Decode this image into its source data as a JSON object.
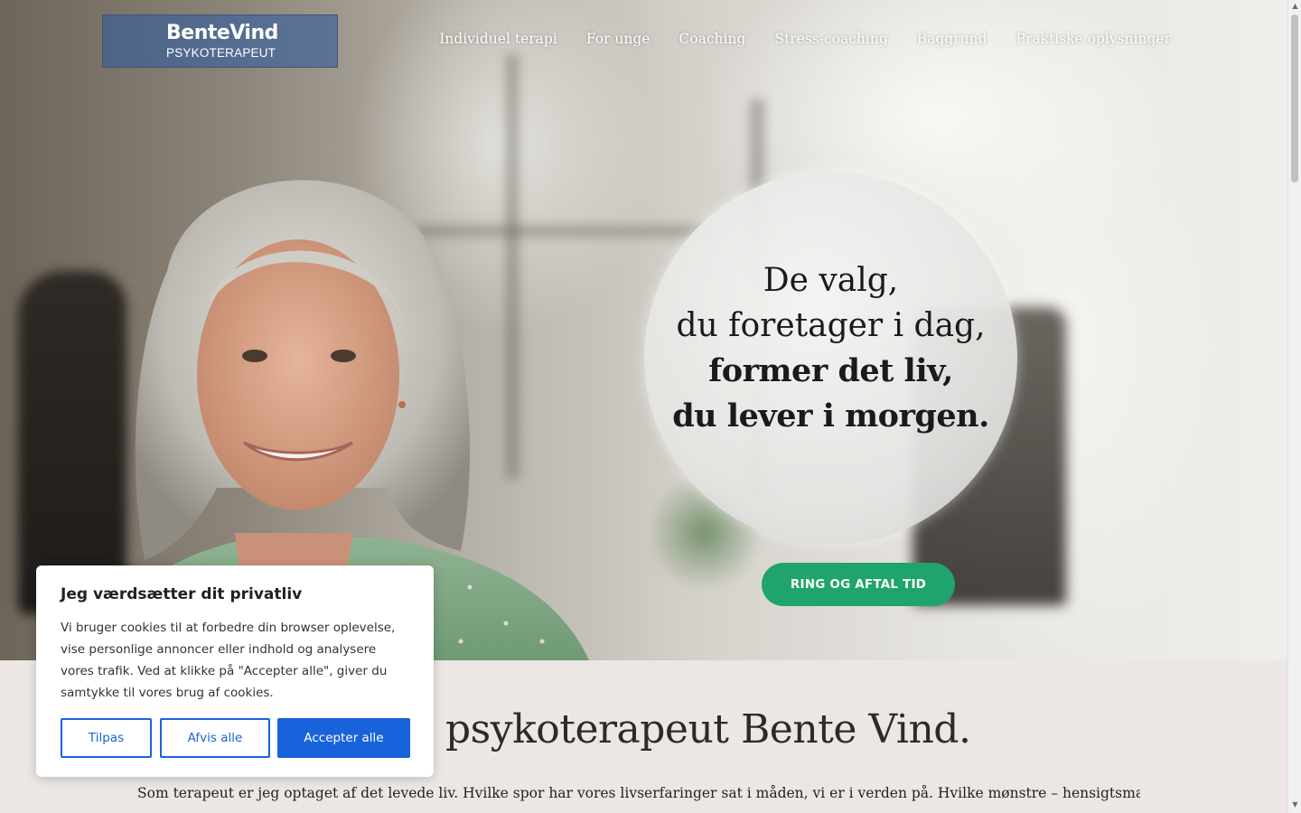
{
  "header": {
    "logo_name": "BenteVind",
    "logo_sub": "PSYKOTERAPEUT",
    "nav": [
      "Individuel terapi",
      "For unge",
      "Coaching",
      "Stress-coaching",
      "Baggrund",
      "Praktiske oplysninger"
    ]
  },
  "hero": {
    "quote_lines": [
      "De valg,",
      "du foretager i dag,",
      "former det liv,",
      "du lever i morgen."
    ],
    "cta_label": "RING OG AFTAL TID"
  },
  "intro": {
    "heading": "psykoterapeut Bente Vind.",
    "text": "Som terapeut er jeg optaget af det levede liv. Hvilke spor har vores livserfaringer sat i måden, vi er i verden på. Hvilke mønstre – hensigtsmæssige eller det"
  },
  "cookie": {
    "title": "Jeg værdsætter dit privatliv",
    "body": "Vi bruger cookies til at forbedre din browser oplevelse, vise personlige annoncer eller indhold og analysere vores trafik. Ved at klikke på \"Accepter alle\", giver du samtykke til vores brug af cookies.",
    "customize_label": "Tilpas",
    "reject_label": "Afvis alle",
    "accept_label": "Accepter alle"
  },
  "colors": {
    "logo_bg": "#4d6487",
    "cta_bg": "#1fa46d",
    "cookie_primary": "#1863dc",
    "content_bg": "#ece7e4"
  },
  "icons": {
    "scroll_up": "scroll-up-arrow-icon",
    "scroll_down": "scroll-down-arrow-icon"
  }
}
